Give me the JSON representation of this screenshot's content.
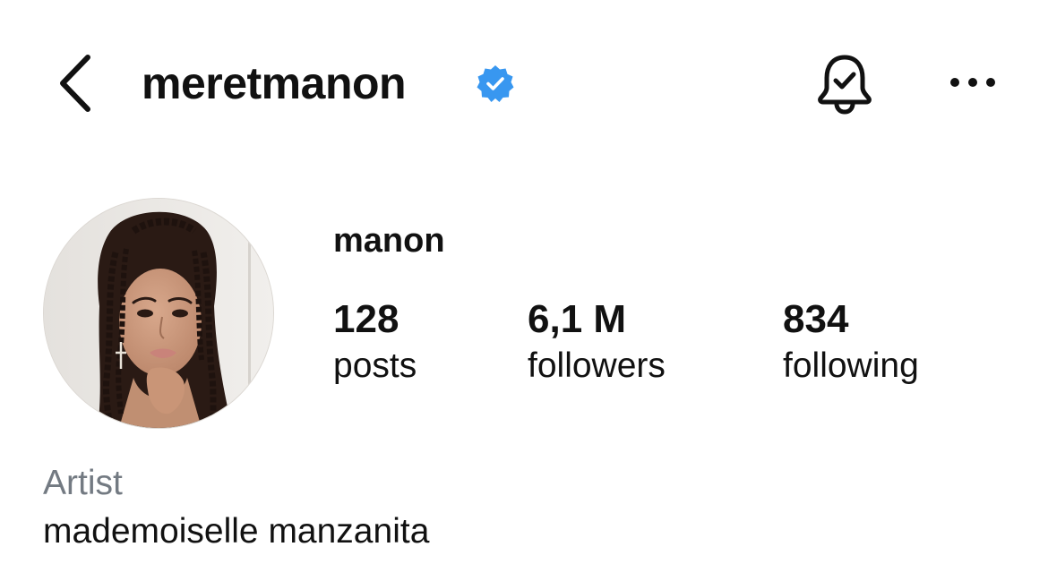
{
  "header": {
    "username": "meretmanon",
    "verified": true,
    "back_icon": "chevron-left-icon",
    "bell_icon": "bell-check-icon",
    "more_icon": "more-horizontal-icon"
  },
  "profile": {
    "display_name": "manon",
    "avatar_icon": "profile-photo",
    "stats": {
      "posts": {
        "value": "128",
        "label": "posts"
      },
      "followers": {
        "value": "6,1 M",
        "label": "followers"
      },
      "following": {
        "value": "834",
        "label": "following"
      }
    },
    "category": "Artist",
    "bio": "mademoiselle manzanita"
  },
  "colors": {
    "verified_blue": "#3897F0",
    "text": "#111111",
    "muted": "#737A82"
  }
}
